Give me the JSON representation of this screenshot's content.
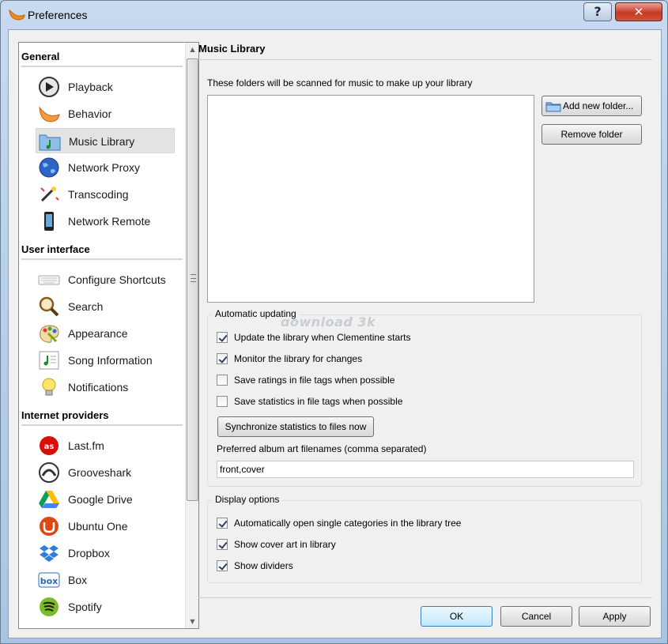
{
  "window": {
    "title": "Preferences",
    "help_label": "?",
    "close_label": "✕"
  },
  "sidebar": {
    "categories": [
      {
        "label": "General",
        "items": [
          {
            "label": "Playback",
            "icon": "play-icon"
          },
          {
            "label": "Behavior",
            "icon": "clementine-icon"
          },
          {
            "label": "Music Library",
            "icon": "music-folder-icon",
            "selected": true
          },
          {
            "label": "Network Proxy",
            "icon": "globe-icon"
          },
          {
            "label": "Transcoding",
            "icon": "magic-wand-icon"
          },
          {
            "label": "Network Remote",
            "icon": "phone-icon"
          }
        ]
      },
      {
        "label": "User interface",
        "items": [
          {
            "label": "Configure Shortcuts",
            "icon": "keyboard-icon"
          },
          {
            "label": "Search",
            "icon": "magnifier-icon"
          },
          {
            "label": "Appearance",
            "icon": "palette-icon"
          },
          {
            "label": "Song Information",
            "icon": "song-info-icon"
          },
          {
            "label": "Notifications",
            "icon": "lightbulb-icon"
          }
        ]
      },
      {
        "label": "Internet providers",
        "items": [
          {
            "label": "Last.fm",
            "icon": "lastfm-icon"
          },
          {
            "label": "Grooveshark",
            "icon": "grooveshark-icon"
          },
          {
            "label": "Google Drive",
            "icon": "google-drive-icon"
          },
          {
            "label": "Ubuntu One",
            "icon": "ubuntu-one-icon"
          },
          {
            "label": "Dropbox",
            "icon": "dropbox-icon"
          },
          {
            "label": "Box",
            "icon": "box-icon"
          },
          {
            "label": "Spotify",
            "icon": "spotify-icon"
          }
        ]
      }
    ]
  },
  "main": {
    "title": "Music Library",
    "intro": "These folders will be scanned for music to make up your library",
    "add_folder_label": "Add new folder...",
    "remove_folder_label": "Remove folder",
    "auto_update": {
      "title": "Automatic updating",
      "checks": [
        {
          "label": "Update the library when Clementine starts",
          "checked": true
        },
        {
          "label": "Monitor the library for changes",
          "checked": true
        },
        {
          "label": "Save ratings in file tags when possible",
          "checked": false
        },
        {
          "label": "Save statistics in file tags when possible",
          "checked": false
        }
      ],
      "sync_label": "Synchronize statistics to files now",
      "art_label": "Preferred album art filenames (comma separated)",
      "art_value": "front,cover"
    },
    "display": {
      "title": "Display options",
      "checks": [
        {
          "label": "Automatically open single categories in the library tree",
          "checked": true
        },
        {
          "label": "Show cover art in library",
          "checked": true
        },
        {
          "label": "Show dividers",
          "checked": true
        }
      ]
    }
  },
  "footer": {
    "ok_label": "OK",
    "cancel_label": "Cancel",
    "apply_label": "Apply"
  },
  "watermark": "download 3k"
}
